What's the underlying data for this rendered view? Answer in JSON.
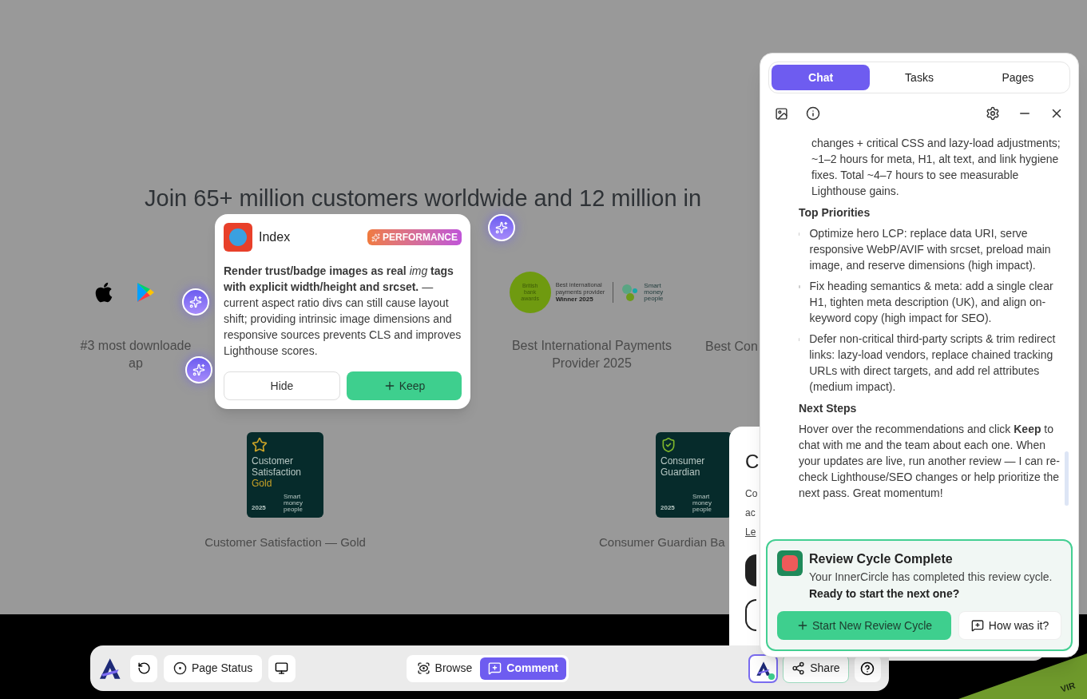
{
  "page": {
    "heading": "Join 65+ million customers worldwide and 12 million in",
    "awards_top": [
      {
        "kind": "apps",
        "caption": [
          "#3 most downloade",
          "ap"
        ]
      },
      {
        "kind": "bank_awards",
        "logo_circle": "British bank awards",
        "logo_lines": [
          "Best international",
          "payments provider"
        ],
        "logo_winner": "Winner 2025",
        "partner": "Smart money people",
        "caption": [
          "Best International Payments",
          "Provider 2025"
        ]
      },
      {
        "kind": "text",
        "caption": [
          "Best Con"
        ]
      }
    ],
    "awards_bottom": [
      {
        "badge": {
          "kind": "star",
          "lines": [
            "Customer",
            "Satisfaction"
          ],
          "highlight": "Gold",
          "year": "2025",
          "partner": "Smart money people"
        },
        "caption": "Customer Satisfaction — Gold"
      },
      {
        "badge": {
          "kind": "shield",
          "lines": [
            "Consumer",
            "Guardian"
          ],
          "year": "2025",
          "partner": "Smart money people"
        },
        "caption": "Consumer Guardian Ba"
      }
    ]
  },
  "background_dialog": {
    "title": "C",
    "lines": [
      "Co",
      "ac"
    ],
    "link": "Le"
  },
  "footer_strip": {
    "text": "VIR"
  },
  "popover": {
    "title": "Index",
    "tag": "PERFORMANCE",
    "body": "**Render trust/badge images as real** *img* **tags with explicit width/height and srcset.** — current aspect ratio divs can still cause layout shift; providing intrinsic image dimensions and responsive sources prevents CLS and improves Lighthouse scores.",
    "hide": "Hide",
    "keep": "Keep"
  },
  "chat": {
    "tabs": [
      {
        "label": "Chat",
        "selected": true
      },
      {
        "label": "Tasks",
        "selected": false
      },
      {
        "label": "Pages",
        "selected": false
      }
    ],
    "messages": [
      {
        "kind": "continuation",
        "text": "changes + critical CSS and lazy-load adjustments; ~1–2 hours for meta, H1, alt text, and link hygiene fixes. Total ~4–7 hours to see measurable Lighthouse gains."
      },
      {
        "kind": "heading",
        "text": "Top Priorities"
      },
      {
        "kind": "bullet",
        "text": "Optimize hero LCP: replace data URI, serve responsive WebP/AVIF with srcset, preload main image, and reserve dimensions (high impact)."
      },
      {
        "kind": "bullet",
        "text": "Fix heading semantics & meta: add a single clear H1, tighten meta description (UK), and align on-keyword copy (high impact for SEO)."
      },
      {
        "kind": "bullet",
        "text": "Defer non-critical third-party scripts & trim redirect links: lazy-load vendors, replace chained tracking URLs with direct targets, and add rel attributes (medium impact)."
      },
      {
        "kind": "heading",
        "text": "Next Steps"
      },
      {
        "kind": "paragraph",
        "text": "Hover over the recommendations and click **Keep** to chat with me and the team about each one. When your updates are live, run another review — I can re-check Lighthouse/SEO changes or help prioritize the next pass. Great momentum!"
      }
    ],
    "review_card": {
      "title": "Review Cycle Complete",
      "text": "Your InnerCircle has completed this review cycle.",
      "question": "Ready to start the next one?",
      "primary": "Start New Review Cycle",
      "secondary": "How was it?"
    }
  },
  "toolbar": {
    "page_status": "Page Status",
    "modes": [
      {
        "kind": "browse",
        "label": "Browse",
        "selected": false
      },
      {
        "kind": "comment",
        "label": "Comment",
        "selected": true
      }
    ],
    "share": "Share"
  }
}
